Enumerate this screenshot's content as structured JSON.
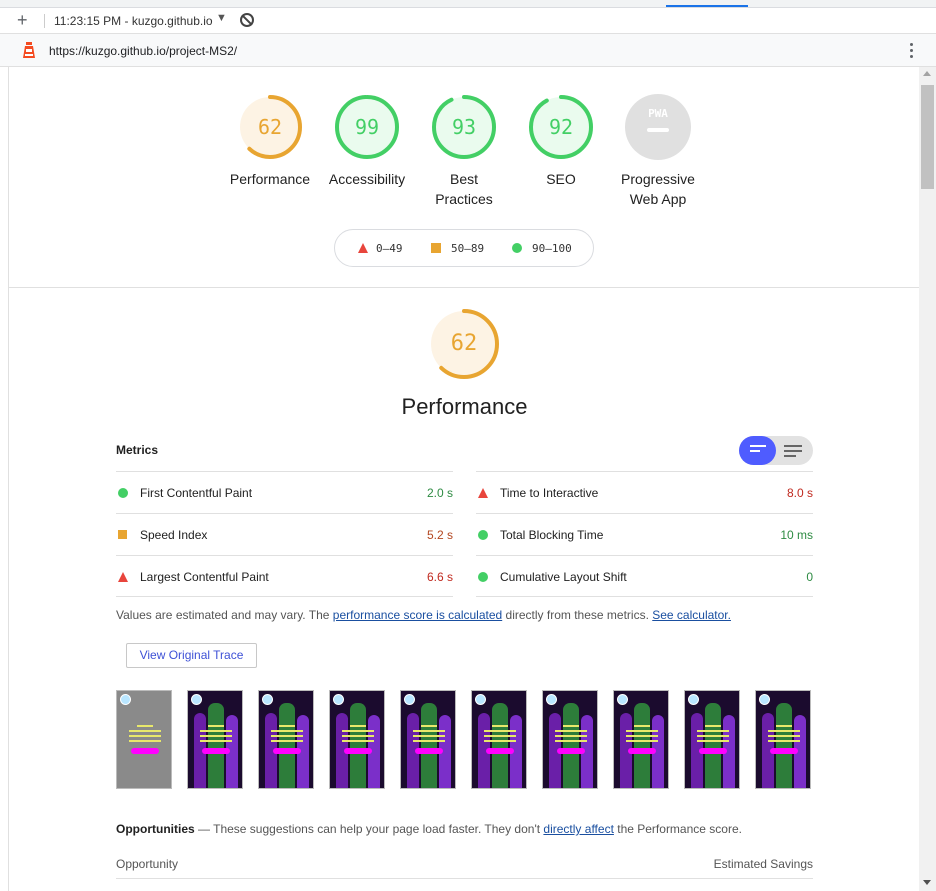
{
  "browser": {
    "timestamp": "11:23:15 PM - kuzgo.github.io",
    "url": "https://kuzgo.github.io/project-MS2/",
    "new_tab_glyph": "+",
    "dropdown_glyph": "▼"
  },
  "categories": [
    {
      "score": "62",
      "label": "Performance",
      "fraction": 0.62,
      "color": "#e8a531",
      "bg": "#fdf3e4"
    },
    {
      "score": "99",
      "label": "Accessibility",
      "fraction": 0.99,
      "color": "#43cf65",
      "bg": "#eafbee"
    },
    {
      "score": "93",
      "label": "Best Practices",
      "fraction": 0.93,
      "color": "#43cf65",
      "bg": "#eafbee"
    },
    {
      "score": "92",
      "label": "SEO",
      "fraction": 0.92,
      "color": "#43cf65",
      "bg": "#eafbee"
    },
    {
      "score": "PWA",
      "label": "Progressive Web App",
      "fraction": 0,
      "color": "#bdbdbd",
      "bg": "#e0e0e0"
    }
  ],
  "legend": {
    "fail": "0–49",
    "average": "50–89",
    "pass": "90–100"
  },
  "performance": {
    "score": "62",
    "fraction": 0.62,
    "title": "Performance",
    "metrics_heading": "Metrics",
    "metrics_left": [
      {
        "name": "First Contentful Paint",
        "value": "2.0 s",
        "rating": "pass",
        "value_color": "#2e8b43"
      },
      {
        "name": "Speed Index",
        "value": "5.2 s",
        "rating": "average",
        "value_color": "#b3461f"
      },
      {
        "name": "Largest Contentful Paint",
        "value": "6.6 s",
        "rating": "fail",
        "value_color": "#c0291f"
      }
    ],
    "metrics_right": [
      {
        "name": "Time to Interactive",
        "value": "8.0 s",
        "rating": "fail",
        "value_color": "#c0291f"
      },
      {
        "name": "Total Blocking Time",
        "value": "10 ms",
        "rating": "pass",
        "value_color": "#2e8b43"
      },
      {
        "name": "Cumulative Layout Shift",
        "value": "0",
        "rating": "pass",
        "value_color": "#2e8b43"
      }
    ],
    "note_pre": "Values are estimated and may vary. The ",
    "note_link1": "performance score is calculated",
    "note_mid": " directly from these metrics. ",
    "note_link2": "See calculator.",
    "trace_button": "View Original Trace",
    "filmstrip_frames": 10
  },
  "opportunities": {
    "title": "Opportunities",
    "dash": " — ",
    "desc_pre": "These suggestions can help your page load faster. They don't ",
    "desc_link": "directly affect",
    "desc_post": " the Performance score.",
    "col_left": "Opportunity",
    "col_right": "Estimated Savings"
  }
}
